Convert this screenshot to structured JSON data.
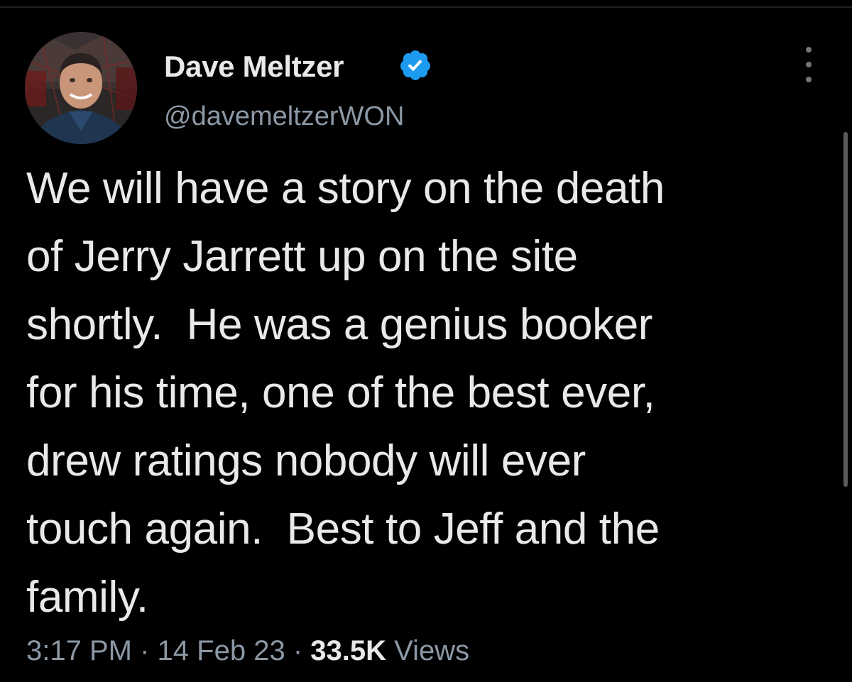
{
  "author": {
    "display_name": "Dave Meltzer",
    "handle": "@davemeltzerWON",
    "verified": true
  },
  "tweet": {
    "lines": [
      "We will have a story on the death",
      "of Jerry Jarrett up on the site",
      "shortly.  He was a genius booker",
      "for his time, one of the best ever,",
      "drew ratings nobody will ever",
      "touch again.  Best to Jeff and the",
      "family."
    ]
  },
  "meta": {
    "time": "3:17 PM",
    "separator": "·",
    "date": "14 Feb 23",
    "views_count": "33.5K",
    "views_label": "Views"
  },
  "icons": {
    "verified": "verified-badge-icon",
    "more": "more-options-icon"
  },
  "colors": {
    "background": "#000000",
    "text": "#e7e9ea",
    "secondary": "#8b98a5",
    "verified": "#1d9bf0"
  }
}
